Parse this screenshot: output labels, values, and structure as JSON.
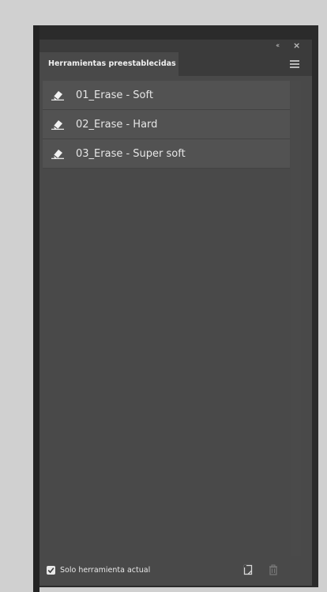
{
  "panel": {
    "tab_label": "Herramientas preestablecidas",
    "collapse_glyph": "‹‹",
    "close_glyph": "×"
  },
  "presets": [
    {
      "label": "01_Erase - Soft",
      "icon": "eraser-icon"
    },
    {
      "label": "02_Erase - Hard",
      "icon": "eraser-icon"
    },
    {
      "label": "03_Erase - Super soft",
      "icon": "eraser-icon"
    }
  ],
  "footer": {
    "current_tool_only_label": "Solo herramienta actual",
    "current_tool_only_checked": true,
    "new_icon": "new-preset-icon",
    "delete_icon": "trash-icon"
  },
  "colors": {
    "panel_bg": "#494949",
    "item_bg": "#525252",
    "text": "#e6e6e6"
  }
}
